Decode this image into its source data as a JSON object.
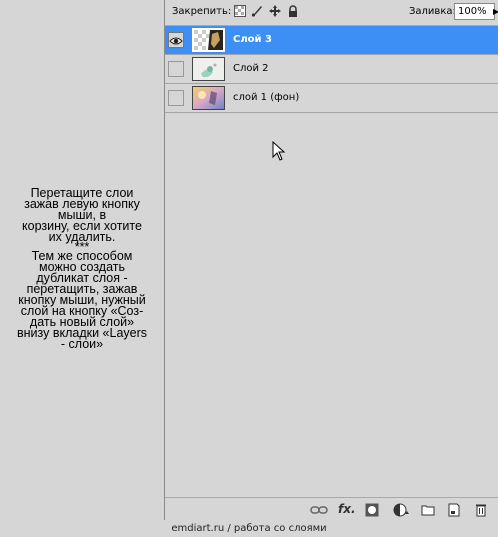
{
  "instructions": {
    "line1": "Перетащите слои",
    "line2": "зажав левую кнопку",
    "line3": "мыши, в",
    "line4": "корзину, если хотите",
    "line5": "их удалить.",
    "separator": "***",
    "line6": "Тем же способом",
    "line7": "можно создать",
    "line8": "дубликат слоя -",
    "line9": "перетащить, зажав",
    "line10": "кнопку мыши, нужный",
    "line11": "слой на кнопку «Соз-",
    "line12": "дать новый слой»",
    "line13": "внизу вкладки  «Layers",
    "line14": "- слои»"
  },
  "toolbar": {
    "lock_label": "Закрепить:",
    "lock_icons": [
      "lock-transparent-pixels-icon",
      "lock-image-pixels-icon",
      "lock-position-icon",
      "lock-all-icon"
    ],
    "fill_label": "Заливка:",
    "fill_value": "100%"
  },
  "layers": [
    {
      "name": "Слой 3",
      "selected": true,
      "visible": true
    },
    {
      "name": "Слой 2",
      "selected": false,
      "visible": false
    },
    {
      "name": "слой 1 (фон)",
      "selected": false,
      "visible": false
    }
  ],
  "footer_icons": [
    "link-layers-icon",
    "fx-icon",
    "layer-mask-icon",
    "adjustment-layer-icon",
    "new-group-icon",
    "new-layer-icon",
    "trash-icon"
  ],
  "footer": {
    "fx_label": "fx."
  },
  "caption": "emdiart.ru  /  работа со слоями",
  "colors": {
    "selection": "#3d8ff5",
    "panel": "#d6d6d6"
  }
}
